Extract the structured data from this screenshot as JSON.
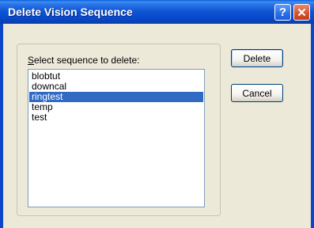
{
  "window": {
    "title": "Delete Vision Sequence",
    "help_glyph": "?",
    "close_glyph": "✕"
  },
  "dialog": {
    "list_label_accel": "S",
    "list_label_rest": "elect sequence to delete:",
    "sequences": [
      {
        "label": "blobtut",
        "selected": false
      },
      {
        "label": "downcal",
        "selected": false
      },
      {
        "label": "ringtest",
        "selected": true
      },
      {
        "label": "temp",
        "selected": false
      },
      {
        "label": "test",
        "selected": false
      }
    ]
  },
  "buttons": {
    "delete_label": "Delete",
    "cancel_label": "Cancel"
  },
  "colors": {
    "titlebar": "#0a5fd8",
    "selection": "#316ac5",
    "face": "#ece9d8"
  }
}
